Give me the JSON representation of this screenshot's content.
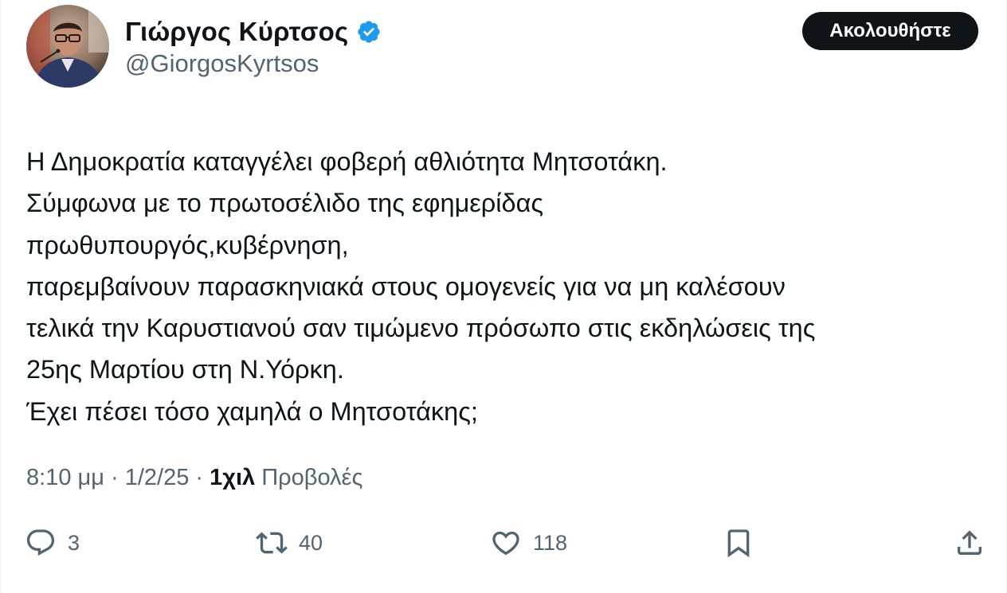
{
  "author": {
    "name": "Γιώργος Κύρτσος",
    "handle": "@GiorgosKyrtsos",
    "verified": true,
    "verified_color": "#1d9bf0"
  },
  "follow_button": {
    "label": "Ακολουθήστε"
  },
  "tweet": {
    "lines": [
      "Η Δημοκρατία καταγγέλει φοβερή αθλιότητα Μητσοτάκη.",
      "Σύμφωνα με το πρωτοσέλιδο της εφημερίδας",
      "πρωθυπουργός,κυβέρνηση,",
      "παρεμβαίνουν παρασκηνιακά στους ομογενείς για να μη καλέσουν",
      "τελικά την Καρυστιανού σαν τιμώμενο πρόσωπο στις εκδηλώσεις της",
      "25ης Μαρτίου στη Ν.Υόρκη.",
      "Έχει πέσει τόσο χαμηλά ο Μητσοτάκης;"
    ]
  },
  "meta": {
    "time": "8:10 μμ",
    "separator": " · ",
    "date": "1/2/25",
    "views_count": "1χιλ",
    "views_label": "Προβολές"
  },
  "actions": {
    "replies": {
      "icon": "reply-icon",
      "count": "3"
    },
    "reposts": {
      "icon": "repost-icon",
      "count": "40"
    },
    "likes": {
      "icon": "heart-icon",
      "count": "118"
    },
    "bookmark": {
      "icon": "bookmark-icon"
    },
    "share": {
      "icon": "share-icon"
    }
  },
  "colors": {
    "text": "#0f1419",
    "secondary": "#536471",
    "follow_bg": "#0f1419",
    "follow_fg": "#ffffff"
  }
}
